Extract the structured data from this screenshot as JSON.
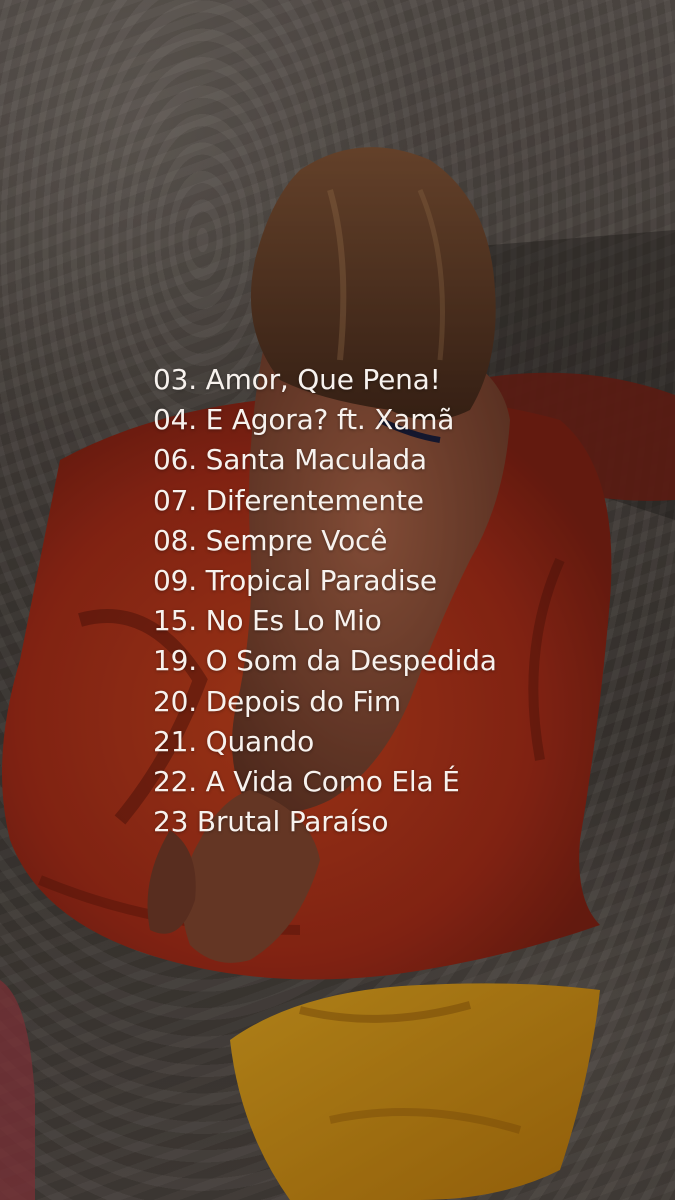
{
  "tracklist": [
    "03. Amor, Que Pena!",
    "04. E Agora? ft. Xamã",
    "06. Santa Maculada",
    "07. Diferentemente",
    "08. Sempre Você",
    "09. Tropical Paradise",
    "15. No Es Lo Mio",
    "19. O Som da Despedida",
    "20. Depois do Fim",
    "21. Quando",
    "22. A Vida Como Ela É",
    "23 Brutal Paraíso"
  ],
  "colors": {
    "text": "#f7f2ee",
    "towel_red": "#c2361c",
    "towel_yellow": "#e9a214",
    "sand": "#6f6660"
  }
}
